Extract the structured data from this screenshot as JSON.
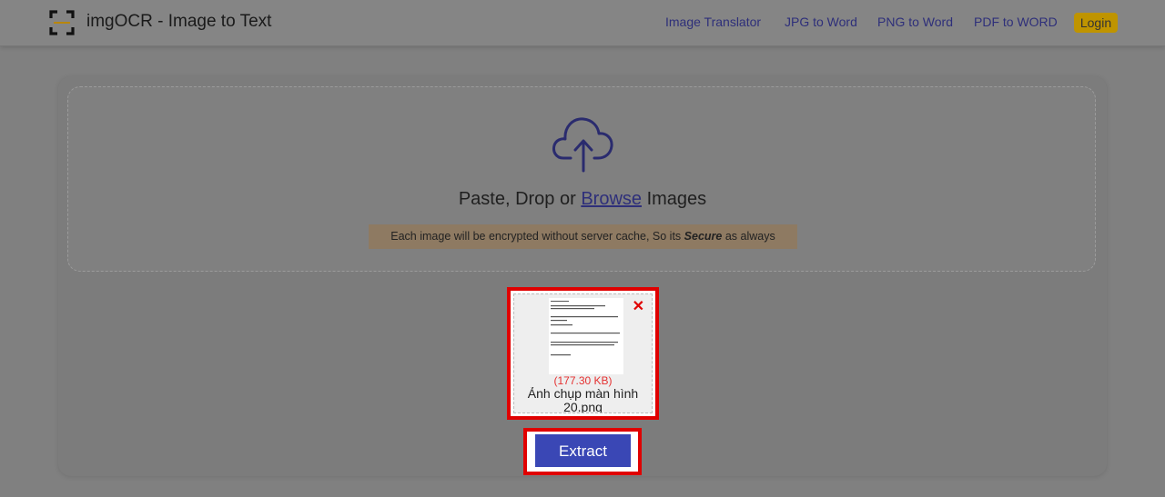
{
  "header": {
    "logo_icon": "scan-frame-icon",
    "brand": "imgOCR - Image to Text",
    "nav": [
      {
        "label": "Image Translator"
      },
      {
        "label": "JPG to Word"
      },
      {
        "label": "PNG to Word"
      },
      {
        "label": "PDF to WORD"
      }
    ],
    "login_label": "Login"
  },
  "upload": {
    "cloud_icon": "cloud-upload-icon",
    "prompt_before": "Paste, Drop or ",
    "browse_label": "Browse",
    "prompt_after": " Images",
    "notice_before": "Each image will be encrypted without server cache, So its ",
    "notice_emphasis": "Secure",
    "notice_after": " as always"
  },
  "file": {
    "size": "(177.30 KB)",
    "name": "Ảnh chụp màn hình 20.png",
    "remove_icon": "close-icon"
  },
  "actions": {
    "extract_label": "Extract"
  },
  "colors": {
    "accent": "#3a47b5",
    "highlight": "#e00000",
    "login_bg": "#bf9400",
    "link": "#2e2f7a"
  }
}
